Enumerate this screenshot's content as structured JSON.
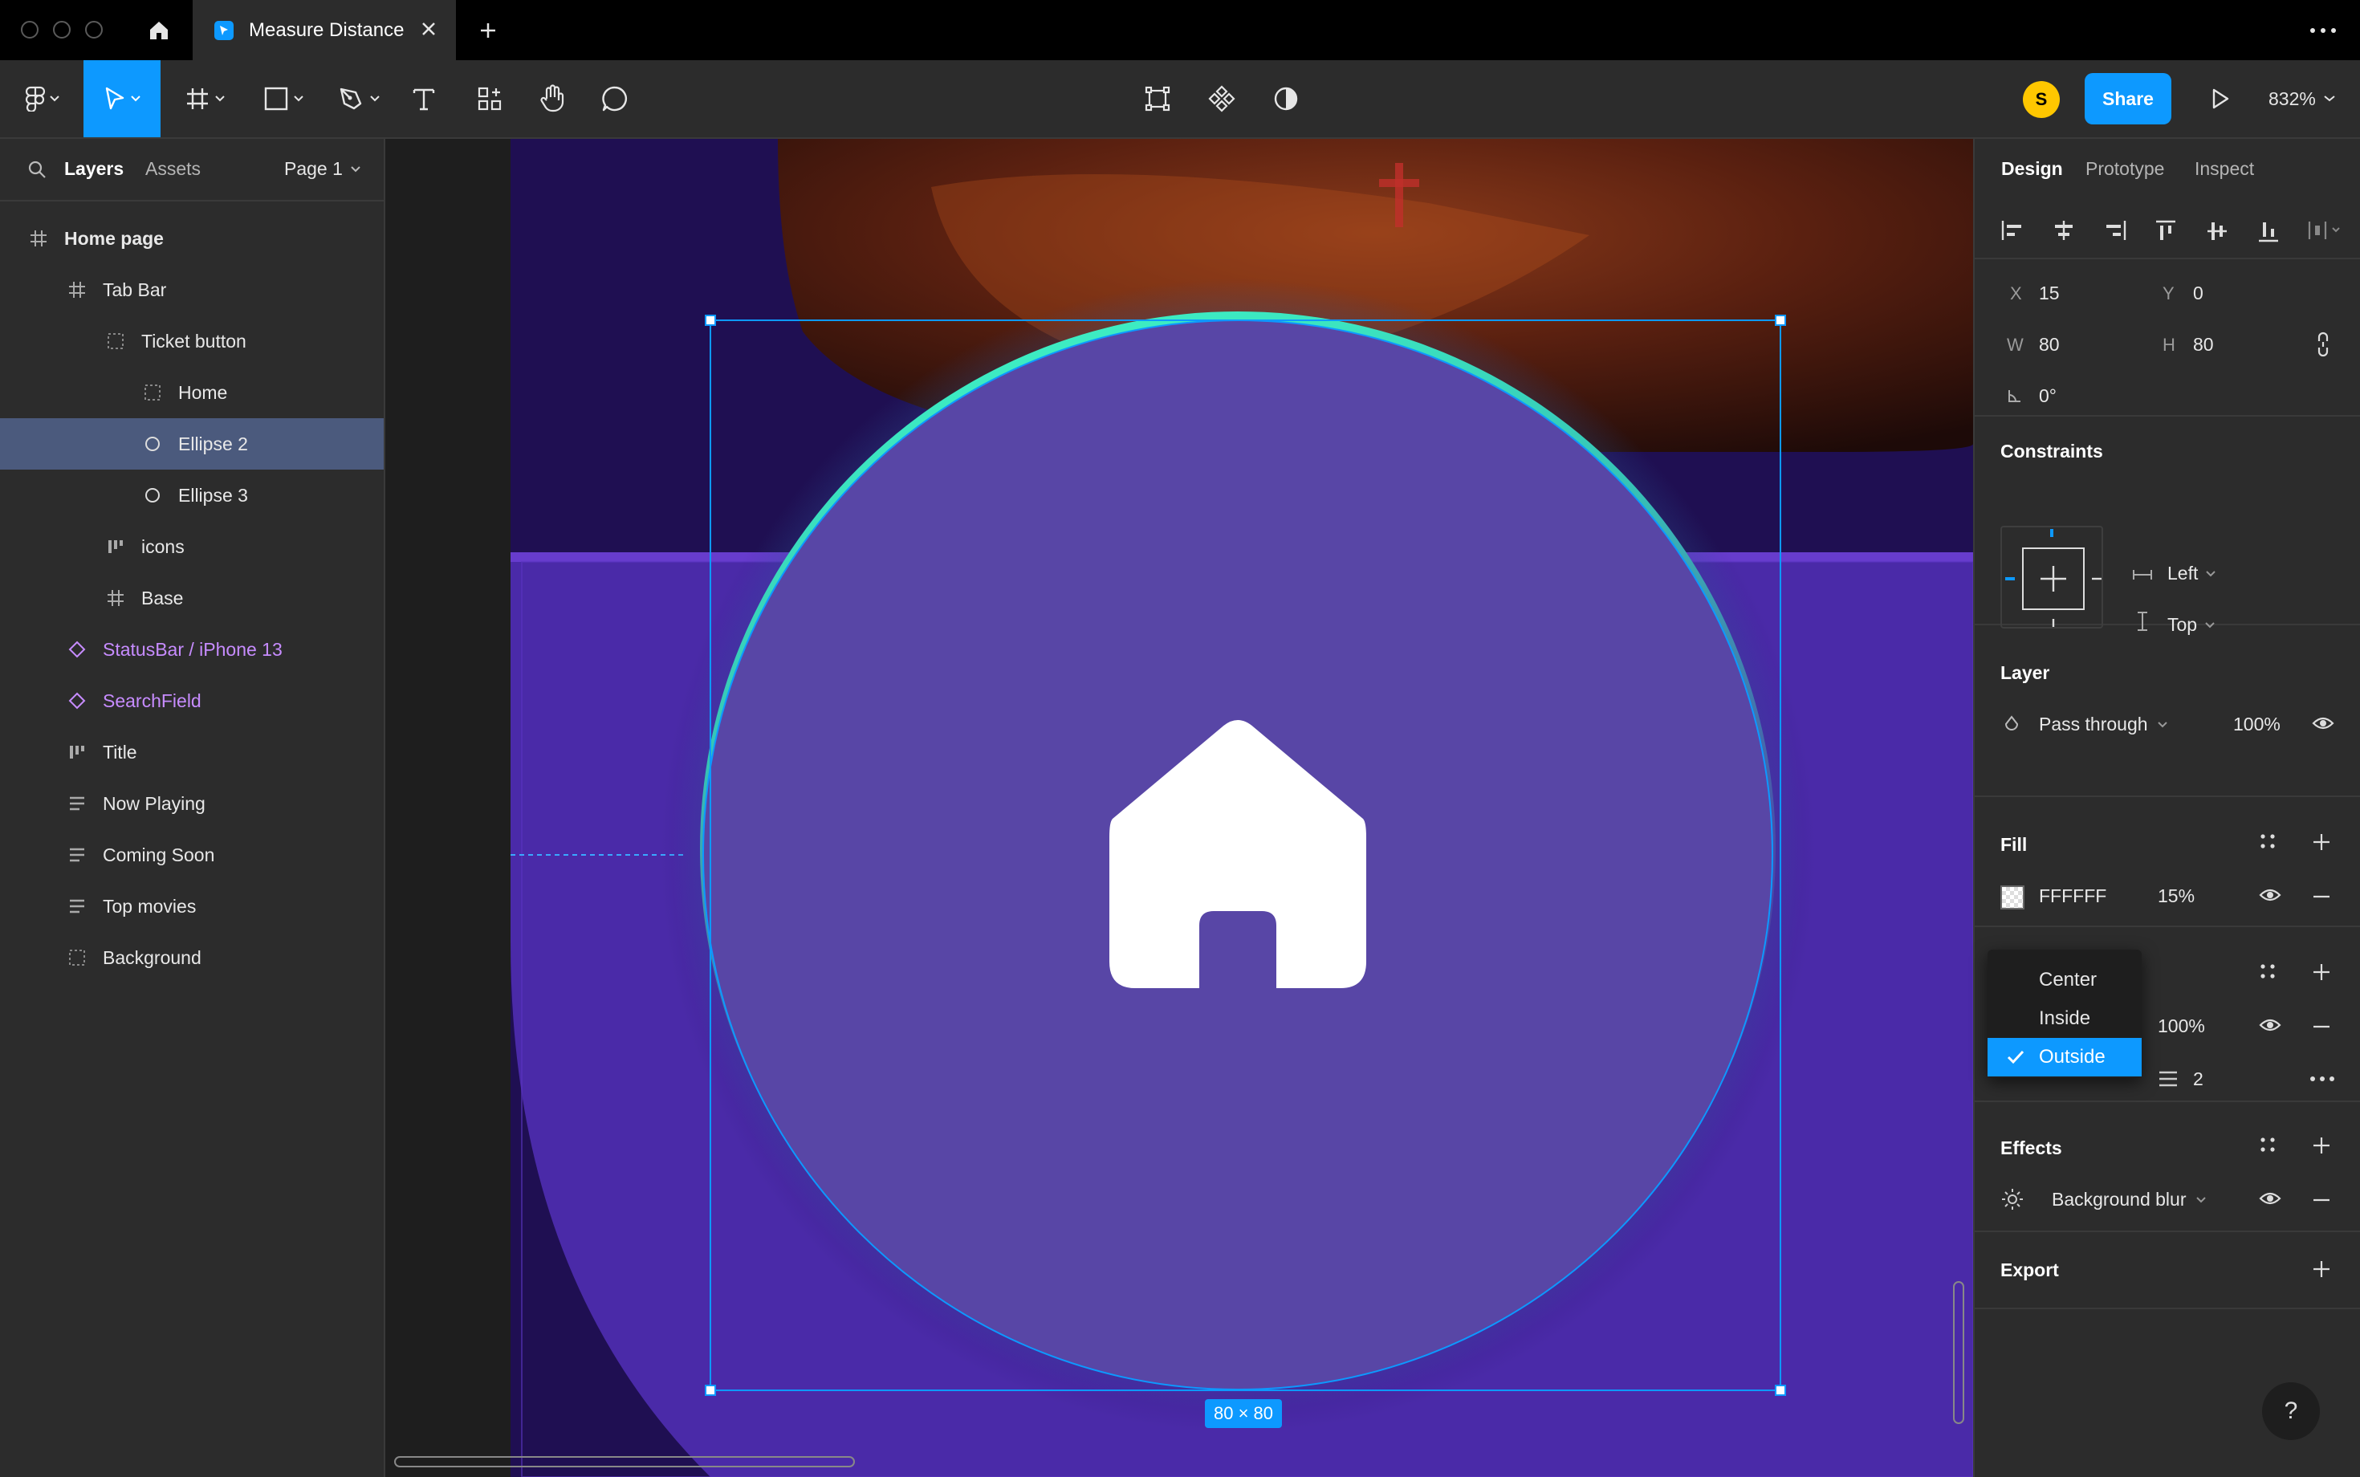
{
  "window": {
    "tab_title": "Measure Distance"
  },
  "toolbar": {
    "avatar_initial": "S",
    "share_label": "Share",
    "zoom": "832%"
  },
  "left_panel": {
    "tabs": [
      "Layers",
      "Assets"
    ],
    "page": "Page 1",
    "layers": [
      {
        "name": "Home page",
        "icon": "frame-icon",
        "indent": 0,
        "selected": false
      },
      {
        "name": "Tab Bar",
        "icon": "frame-icon",
        "indent": 1,
        "selected": false
      },
      {
        "name": "Ticket button",
        "icon": "group-icon",
        "indent": 2,
        "selected": false
      },
      {
        "name": "Home",
        "icon": "group-icon",
        "indent": 3,
        "selected": false
      },
      {
        "name": "Ellipse 2",
        "icon": "ellipse-icon",
        "indent": 3,
        "selected": true
      },
      {
        "name": "Ellipse 3",
        "icon": "ellipse-icon",
        "indent": 3,
        "selected": false
      },
      {
        "name": "icons",
        "icon": "autolayout-icon",
        "indent": 2,
        "selected": false
      },
      {
        "name": "Base",
        "icon": "frame-icon",
        "indent": 2,
        "selected": false
      },
      {
        "name": "StatusBar / iPhone 13",
        "icon": "instance-icon",
        "indent": 1,
        "selected": false
      },
      {
        "name": "SearchField",
        "icon": "instance-icon",
        "indent": 1,
        "selected": false
      },
      {
        "name": "Title",
        "icon": "autolayout-icon",
        "indent": 1,
        "selected": false
      },
      {
        "name": "Now Playing",
        "icon": "text-lines-icon",
        "indent": 1,
        "selected": false
      },
      {
        "name": "Coming Soon",
        "icon": "text-lines-icon",
        "indent": 1,
        "selected": false
      },
      {
        "name": "Top movies",
        "icon": "text-lines-icon",
        "indent": 1,
        "selected": false
      },
      {
        "name": "Background",
        "icon": "group-icon",
        "indent": 1,
        "selected": false
      }
    ]
  },
  "canvas": {
    "size_label": "80 × 80"
  },
  "right_panel": {
    "tabs": [
      "Design",
      "Prototype",
      "Inspect"
    ],
    "position": {
      "x_label": "X",
      "x": "15",
      "y_label": "Y",
      "y": "0",
      "w_label": "W",
      "w": "80",
      "h_label": "H",
      "h": "80",
      "rotation": "0°"
    },
    "constraints": {
      "title": "Constraints",
      "horizontal": "Left",
      "vertical": "Top"
    },
    "layer": {
      "title": "Layer",
      "blend": "Pass through",
      "opacity": "100%"
    },
    "fill": {
      "title": "Fill",
      "hex": "FFFFFF",
      "opacity": "15%"
    },
    "stroke": {
      "opacity": "100%",
      "weight": "2"
    },
    "stroke_position_options": [
      "Center",
      "Inside",
      "Outside"
    ],
    "stroke_position_selected": "Outside",
    "effects": {
      "title": "Effects",
      "effect": "Background blur"
    },
    "export": {
      "title": "Export"
    },
    "help": "?"
  },
  "colors": {
    "accent": "#0d99ff",
    "selection": "#4b5a7d",
    "component": "#c78cff",
    "frame_purple": "#4a2aa8",
    "ring_green": "#3ef2c4"
  }
}
